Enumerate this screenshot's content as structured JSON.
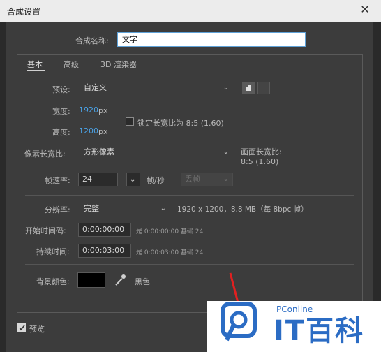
{
  "window": {
    "title": "合成设置",
    "close_icon": "close-icon"
  },
  "comp_name": {
    "label": "合成名称:",
    "value": "文字"
  },
  "tabs": [
    {
      "label": "基本",
      "selected": true
    },
    {
      "label": "高级",
      "selected": false
    },
    {
      "label": "3D 渲染器",
      "selected": false
    }
  ],
  "preset": {
    "label": "预设:",
    "value": "自定义"
  },
  "width": {
    "label": "宽度:",
    "value": "1920",
    "unit": "px"
  },
  "height": {
    "label": "高度:",
    "value": "1200",
    "unit": "px"
  },
  "lock_ratio": {
    "label": "锁定长宽比为 8:5 (1.60)",
    "checked": false
  },
  "pixel_aspect": {
    "label": "像素长宽比:",
    "value": "方形像素"
  },
  "frame_aspect": {
    "label": "画面长宽比:",
    "value": "8:5 (1.60)"
  },
  "frame_rate": {
    "label": "帧速率:",
    "value": "24",
    "unit": "帧/秒",
    "drop_frame": "丢帧"
  },
  "resolution": {
    "label": "分辨率:",
    "value": "完整",
    "info": "1920 x 1200，8.8 MB（每 8bpc 帧）"
  },
  "start_timecode": {
    "label": "开始时间码:",
    "value": "0:00:00:00",
    "note": "是 0:00:00:00  基础 24"
  },
  "duration": {
    "label": "持续时间:",
    "value": "0:00:03:00",
    "note": "是 0:00:03:00  基础 24"
  },
  "background": {
    "label": "背景颜色:",
    "color": "#000000",
    "name": "黑色"
  },
  "preview": {
    "label": "预览",
    "checked": true
  },
  "watermark": {
    "small": "PConline",
    "big": "IT百科"
  },
  "colors": {
    "accent": "#4aa3e8",
    "dialog_bg": "#3c3c3c",
    "title_bg": "#ececec"
  }
}
